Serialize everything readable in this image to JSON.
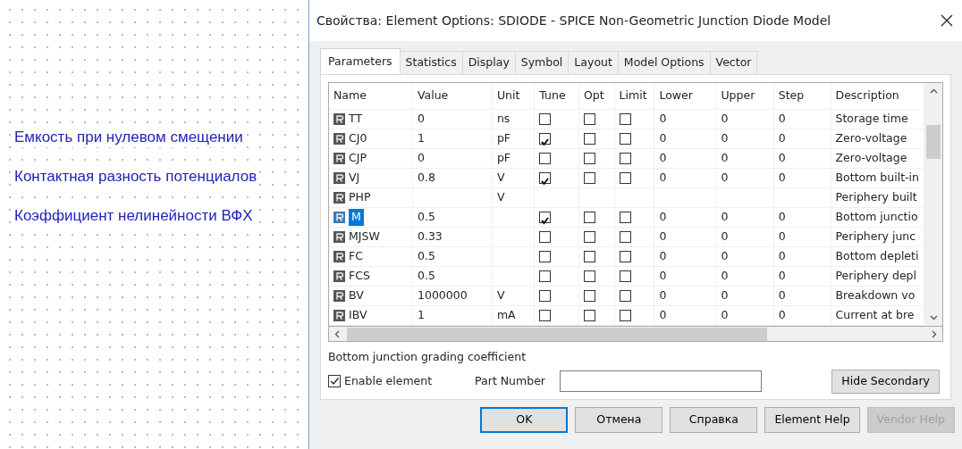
{
  "canvas": {
    "labels": [
      "Емкость при нулевом смещении",
      "Контактная разность потенциалов",
      "Коэффициент нелинейности ВФХ"
    ]
  },
  "window": {
    "title": "Свойства: Element Options: SDIODE - SPICE Non-Geometric Junction Diode Model"
  },
  "tabs": [
    {
      "label": "Parameters",
      "selected": true
    },
    {
      "label": "Statistics",
      "selected": false
    },
    {
      "label": "Display",
      "selected": false
    },
    {
      "label": "Symbol",
      "selected": false
    },
    {
      "label": "Layout",
      "selected": false
    },
    {
      "label": "Model Options",
      "selected": false
    },
    {
      "label": "Vector",
      "selected": false
    }
  ],
  "table": {
    "columns": [
      "Name",
      "Value",
      "Unit",
      "Tune",
      "Opt",
      "Limit",
      "Lower",
      "Upper",
      "Step",
      "Description"
    ],
    "rows": [
      {
        "name": "TT",
        "value": "0",
        "unit": "ns",
        "tune": false,
        "opt": false,
        "limit": false,
        "lower": "0",
        "upper": "0",
        "step": "0",
        "description": "Storage time",
        "selected": false
      },
      {
        "name": "CJ0",
        "value": "1",
        "unit": "pF",
        "tune": true,
        "opt": false,
        "limit": false,
        "lower": "0",
        "upper": "0",
        "step": "0",
        "description": "Zero-voltage",
        "selected": false
      },
      {
        "name": "CJP",
        "value": "0",
        "unit": "pF",
        "tune": false,
        "opt": false,
        "limit": false,
        "lower": "0",
        "upper": "0",
        "step": "0",
        "description": "Zero-voltage",
        "selected": false
      },
      {
        "name": "VJ",
        "value": "0.8",
        "unit": "V",
        "tune": true,
        "opt": false,
        "limit": false,
        "lower": "0",
        "upper": "0",
        "step": "0",
        "description": "Bottom built-in",
        "selected": false
      },
      {
        "name": "PHP",
        "unit": "V",
        "description": "Periphery built",
        "selected": false
      },
      {
        "name": "M",
        "value": "0.5",
        "tune": true,
        "opt": false,
        "limit": false,
        "lower": "0",
        "upper": "0",
        "step": "0",
        "description": "Bottom junctio",
        "selected": true
      },
      {
        "name": "MJSW",
        "value": "0.33",
        "tune": false,
        "opt": false,
        "limit": false,
        "lower": "0",
        "upper": "0",
        "step": "0",
        "description": "Periphery junc",
        "selected": false
      },
      {
        "name": "FC",
        "value": "0.5",
        "tune": false,
        "opt": false,
        "limit": false,
        "lower": "0",
        "upper": "0",
        "step": "0",
        "description": "Bottom depleti",
        "selected": false
      },
      {
        "name": "FCS",
        "value": "0.5",
        "tune": false,
        "opt": false,
        "limit": false,
        "lower": "0",
        "upper": "0",
        "step": "0",
        "description": "Periphery depl",
        "selected": false
      },
      {
        "name": "BV",
        "value": "1000000",
        "unit": "V",
        "tune": false,
        "opt": false,
        "limit": false,
        "lower": "0",
        "upper": "0",
        "step": "0",
        "description": "Breakdown vo",
        "selected": false
      },
      {
        "name": "IBV",
        "value": "1",
        "unit": "mA",
        "tune": false,
        "opt": false,
        "limit": false,
        "lower": "0",
        "upper": "0",
        "step": "0",
        "description": "Current at bre",
        "selected": false
      }
    ]
  },
  "hint": "Bottom junction grading coefficient",
  "enable_element": {
    "label": "Enable element",
    "checked": true
  },
  "part_number": {
    "label": "Part Number"
  },
  "hide_secondary": "Hide Secondary",
  "buttons": [
    {
      "label": "OK",
      "kind": "default"
    },
    {
      "label": "Отмена",
      "kind": "normal"
    },
    {
      "label": "Справка",
      "kind": "normal"
    },
    {
      "label": "Element Help",
      "kind": "normal"
    },
    {
      "label": "Vendor Help",
      "kind": "disabled"
    }
  ]
}
